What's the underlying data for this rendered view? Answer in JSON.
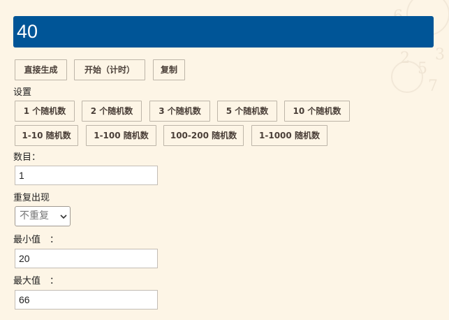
{
  "result": {
    "value": "40"
  },
  "actions": {
    "generate_label": "直接生成",
    "start_timer_label": "开始（计时）",
    "copy_label": "复制"
  },
  "settings": {
    "title": "设置",
    "presets_row1": [
      "1 个随机数",
      "2 个随机数",
      "3 个随机数",
      "5 个随机数",
      "10 个随机数"
    ],
    "presets_row2": [
      "1-10 随机数",
      "1-100 随机数",
      "100-200 随机数",
      "1-1000 随机数"
    ]
  },
  "form": {
    "count_label": "数目：",
    "count_value": "1",
    "repeat_label": "重复出现",
    "repeat_selected": "不重复",
    "min_label": "最小值　：",
    "min_value": "20",
    "max_label": "最大值　：",
    "max_value": "66"
  },
  "colors": {
    "result_bg": "#005597",
    "page_bg": "#fdf5e6"
  },
  "icons": {
    "select_arrow": "chevron-down-icon"
  }
}
